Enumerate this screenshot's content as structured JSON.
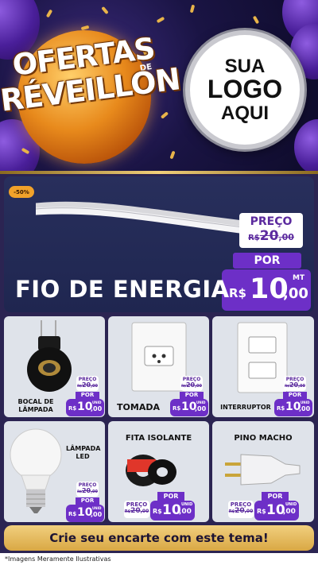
{
  "header": {
    "badge_line1": "OFERTAS",
    "badge_de": "DE",
    "badge_line2": "RÉVEILLON",
    "logo_line1": "SUA",
    "logo_line2": "LOGO",
    "logo_line3": "AQUI"
  },
  "hero": {
    "discount_tag": "-50%",
    "title": "FIO DE ENERGIA",
    "preco_label": "PREÇO",
    "old_currency": "R$",
    "old_int": "20",
    "old_dec": ",00",
    "por_label": "POR",
    "currency": "R$",
    "price_int": "10",
    "price_dec": ",00",
    "unit": "MT"
  },
  "products": [
    {
      "name": "BOCAL DE LÂMPADA",
      "preco_label": "PREÇO",
      "old_currency": "R$",
      "old_int": "20",
      "old_dec": ",00",
      "por_label": "POR",
      "currency": "R$",
      "price_int": "10",
      "price_dec": ",00",
      "unit": "UNID"
    },
    {
      "name": "TOMADA",
      "preco_label": "PREÇO",
      "old_currency": "R$",
      "old_int": "20",
      "old_dec": ",00",
      "por_label": "POR",
      "currency": "R$",
      "price_int": "10",
      "price_dec": ",00",
      "unit": "UNID"
    },
    {
      "name": "INTERRUPTOR",
      "preco_label": "PREÇO",
      "old_currency": "R$",
      "old_int": "20",
      "old_dec": ",00",
      "por_label": "POR",
      "currency": "R$",
      "price_int": "10",
      "price_dec": ",00",
      "unit": "UNID"
    },
    {
      "name": "LÂMPADA LED",
      "preco_label": "PREÇO",
      "old_currency": "R$",
      "old_int": "20",
      "old_dec": ",00",
      "por_label": "POR",
      "currency": "R$",
      "price_int": "10",
      "price_dec": ",00",
      "unit": "UNID"
    },
    {
      "name": "FITA ISOLANTE",
      "preco_label": "PREÇO",
      "old_currency": "R$",
      "old_int": "20",
      "old_dec": ",00",
      "por_label": "POR",
      "currency": "R$",
      "price_int": "10",
      "price_dec": ",00",
      "unit": "UNID"
    },
    {
      "name": "PINO MACHO",
      "preco_label": "PREÇO",
      "old_currency": "R$",
      "old_int": "20",
      "old_dec": ",00",
      "por_label": "POR",
      "currency": "R$",
      "price_int": "10",
      "price_dec": ",00",
      "unit": "UNID"
    }
  ],
  "cta": "Crie seu encarte com este tema!",
  "footer_note": "*Imagens Meramente Ilustrativas",
  "colors": {
    "accent_purple": "#6d2fc7",
    "gold": "#e0b454",
    "card_bg": "#dfe3ea",
    "panel_bg": "#2b2452"
  }
}
